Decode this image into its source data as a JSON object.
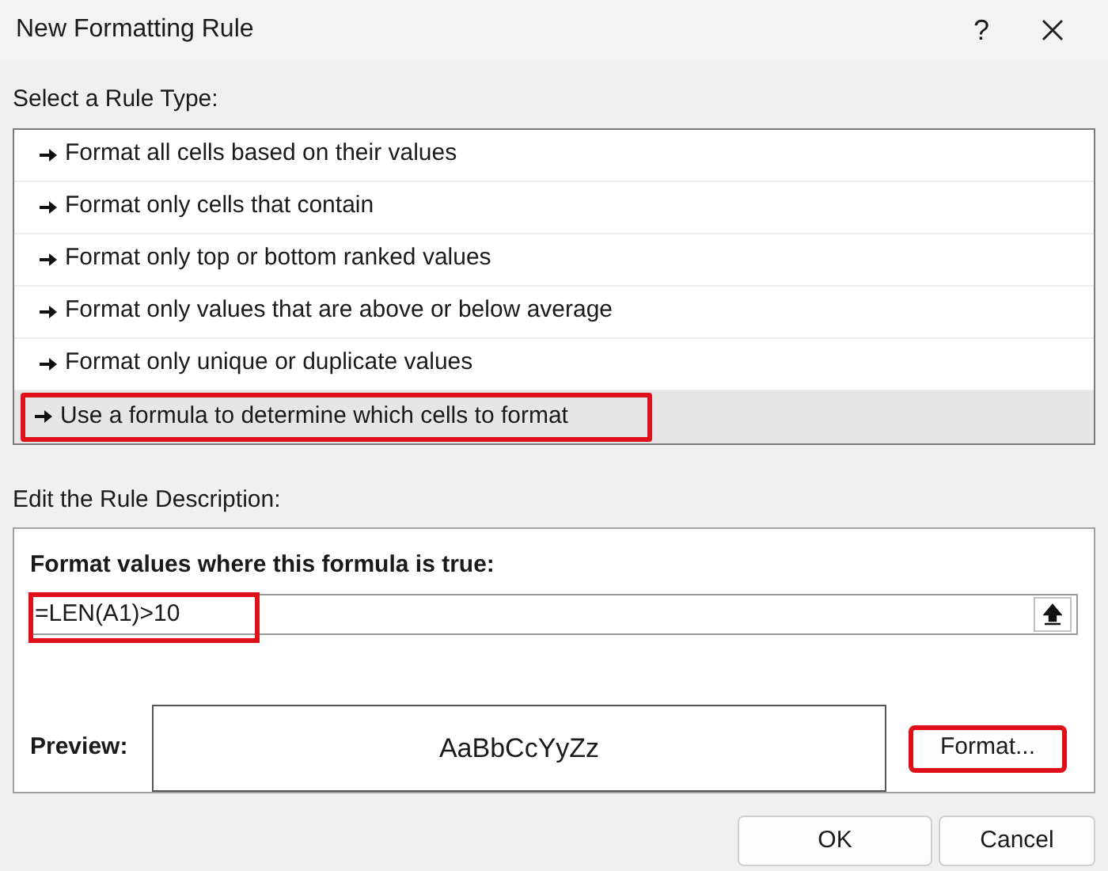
{
  "window": {
    "title": "New Formatting Rule",
    "help": "?"
  },
  "rule_type": {
    "label": "Select a Rule Type:",
    "items": [
      {
        "label": "Format all cells based on their values",
        "selected": false,
        "highlighted": false
      },
      {
        "label": "Format only cells that contain",
        "selected": false,
        "highlighted": false
      },
      {
        "label": "Format only top or bottom ranked values",
        "selected": false,
        "highlighted": false
      },
      {
        "label": "Format only values that are above or below average",
        "selected": false,
        "highlighted": false
      },
      {
        "label": "Format only unique or duplicate values",
        "selected": false,
        "highlighted": false
      },
      {
        "label": "Use a formula to determine which cells to format",
        "selected": true,
        "highlighted": true
      }
    ]
  },
  "description": {
    "label": "Edit the Rule Description:",
    "formula_label": "Format values where this formula is true:",
    "formula": {
      "value": "=LEN(A1)>10",
      "highlighted": true
    },
    "preview_label": "Preview:",
    "preview_text": "AaBbCcYyZz",
    "format_button": {
      "label": "Format...",
      "highlighted": true
    }
  },
  "buttons": [
    "OK",
    "Cancel"
  ]
}
